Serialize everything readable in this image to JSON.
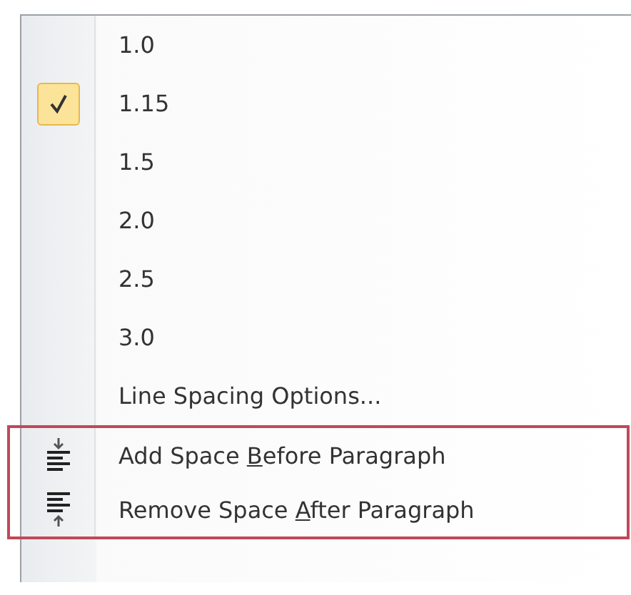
{
  "menu": {
    "items": [
      {
        "label": "1.0",
        "selected": false
      },
      {
        "label": "1.15",
        "selected": true
      },
      {
        "label": "1.5",
        "selected": false
      },
      {
        "label": "2.0",
        "selected": false
      },
      {
        "label": "2.5",
        "selected": false
      },
      {
        "label": "3.0",
        "selected": false
      },
      {
        "label": "Line Spacing Options...",
        "selected": false
      }
    ],
    "highlight_group": {
      "items": [
        {
          "kind": "space-before",
          "label_start": "Add Space ",
          "access_key": "B",
          "label_end": "efore Paragraph"
        },
        {
          "kind": "space-after",
          "label_start": "Remove Space ",
          "access_key": "A",
          "label_end": "fter Paragraph"
        }
      ]
    }
  }
}
